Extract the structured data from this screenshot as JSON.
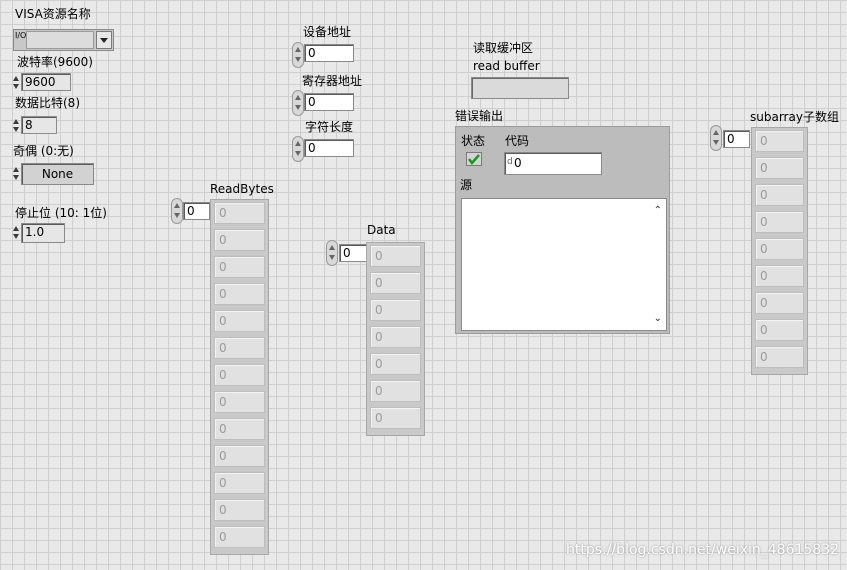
{
  "visa": {
    "label": "VISA资源名称",
    "prefix": "I/O",
    "value": ""
  },
  "baud": {
    "label": "波特率(9600)",
    "value": "9600"
  },
  "databits": {
    "label": "数据比特(8)",
    "value": "8"
  },
  "parity": {
    "label": "奇偶  (0:无)",
    "value": "None"
  },
  "stopbits": {
    "label": "停止位  (10: 1位)",
    "value": "1.0"
  },
  "device": {
    "label": "设备地址",
    "value": "0"
  },
  "register": {
    "label": "寄存器地址",
    "value": "0"
  },
  "charlen": {
    "label": "字符长度",
    "value": "0"
  },
  "readbuf": {
    "label1": "读取缓冲区",
    "label2": "read buffer",
    "value": ""
  },
  "error": {
    "label": "错误输出",
    "status_label": "状态",
    "code_label": "代码",
    "code_value": "0",
    "code_prefix": "d",
    "source_label": "源",
    "source_value": ""
  },
  "readbytes": {
    "label": "ReadBytes",
    "index": "0",
    "cells": [
      "0",
      "0",
      "0",
      "0",
      "0",
      "0",
      "0",
      "0",
      "0",
      "0",
      "0",
      "0",
      "0"
    ]
  },
  "data": {
    "label": "Data",
    "index": "0",
    "cells": [
      "0",
      "0",
      "0",
      "0",
      "0",
      "0",
      "0"
    ]
  },
  "subarray": {
    "label": "subarray子数组",
    "index": "0",
    "cells": [
      "0",
      "0",
      "0",
      "0",
      "0",
      "0",
      "0",
      "0",
      "0"
    ]
  },
  "watermark": "https://blog.csdn.net/weixin_48615832"
}
